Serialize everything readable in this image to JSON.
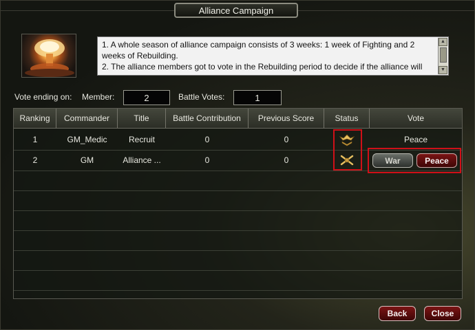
{
  "window": {
    "title": "Alliance Campaign"
  },
  "info": {
    "lines": [
      "1. A whole season of alliance campaign consists of 3 weeks: 1 week of Fighting and 2 weeks of Rebuilding.",
      "2. The alliance members got to vote in the Rebuilding period to decide if the alliance will"
    ]
  },
  "summary": {
    "vote_ending_label": "Vote ending on:",
    "member_label": "Member:",
    "member_value": "2",
    "battle_votes_label": "Battle Votes:",
    "battle_votes_value": "1"
  },
  "table": {
    "headers": [
      "Ranking",
      "Commander",
      "Title",
      "Battle Contribution",
      "Previous Score",
      "Status",
      "Vote"
    ],
    "rows": [
      {
        "ranking": "1",
        "commander": "GM_Medic",
        "title": "Recruit",
        "battle_contribution": "0",
        "previous_score": "0",
        "status_icon": "eagle-rank-icon",
        "vote": "Peace"
      },
      {
        "ranking": "2",
        "commander": "GM",
        "title": "Alliance ...",
        "battle_contribution": "0",
        "previous_score": "0",
        "status_icon": "crossed-guns-rank-icon",
        "vote": ""
      }
    ]
  },
  "vote_buttons": {
    "war_label": "War",
    "peace_label": "Peace"
  },
  "footer": {
    "back_label": "Back",
    "close_label": "Close"
  },
  "colors": {
    "highlight": "#d01018",
    "button_red": "#7a1414"
  }
}
